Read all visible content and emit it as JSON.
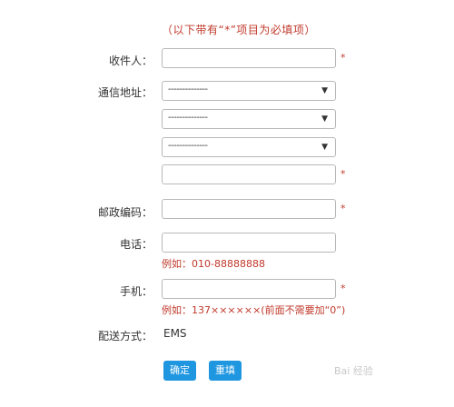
{
  "notice": "（以下带有“*”项目为必填项）",
  "required_mark": "*",
  "fields": {
    "recipient": {
      "label": "收件人：",
      "value": ""
    },
    "address": {
      "label": "通信地址：",
      "selects": [
        "--------------",
        "--------------",
        "--------------"
      ],
      "detail_value": ""
    },
    "postcode": {
      "label": "邮政编码：",
      "value": ""
    },
    "phone": {
      "label": "电话：",
      "value": "",
      "hint": "例如：010-88888888"
    },
    "mobile": {
      "label": "手机：",
      "value": "",
      "hint": "例如：137××××××(前面不需要加“0”)"
    },
    "delivery": {
      "label": "配送方式：",
      "value": "EMS"
    }
  },
  "buttons": {
    "confirm": "确定",
    "reset": "重填"
  },
  "watermark": "Bai 经验",
  "icons": {
    "dropdown": "chevron-down-icon"
  },
  "colors": {
    "accent": "#1e96e0",
    "required": "#c0392b",
    "border": "#b8b8b8"
  }
}
